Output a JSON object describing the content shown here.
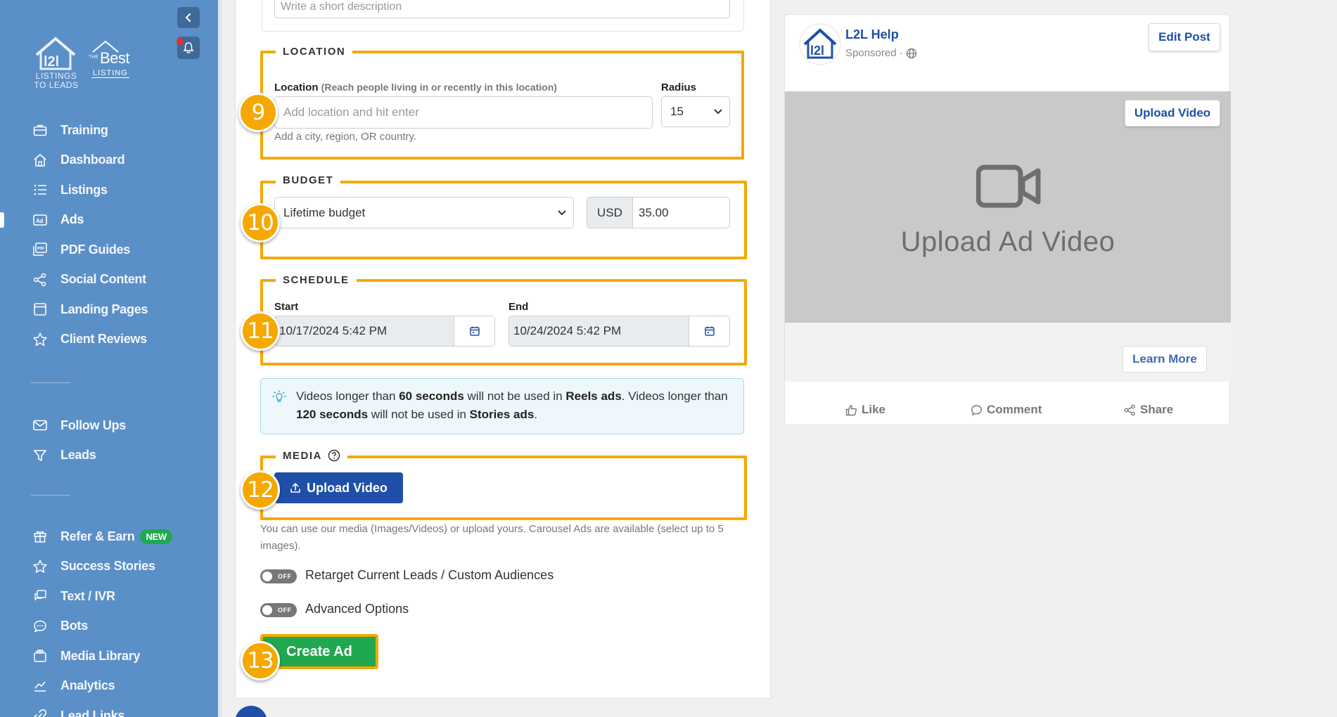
{
  "sidebar": {
    "logo_l2l_caption_1": "LISTINGS",
    "logo_l2l_caption_2": "TO LEADS",
    "logo_best_prefix": "THE",
    "logo_best_main": "Best",
    "logo_best_sub": "LISTING",
    "items": [
      {
        "label": "Training",
        "icon": "briefcase-icon"
      },
      {
        "label": "Dashboard",
        "icon": "home-icon"
      },
      {
        "label": "Listings",
        "icon": "list-icon"
      },
      {
        "label": "Ads",
        "icon": "ad-icon",
        "active": true
      },
      {
        "label": "PDF Guides",
        "icon": "pdf-icon"
      },
      {
        "label": "Social Content",
        "icon": "share-icon"
      },
      {
        "label": "Landing Pages",
        "icon": "window-icon"
      },
      {
        "label": "Client Reviews",
        "icon": "star-icon"
      },
      {
        "label": "Follow Ups",
        "icon": "envelope-icon"
      },
      {
        "label": "Leads",
        "icon": "filter-icon"
      },
      {
        "label": "Refer & Earn",
        "icon": "gift-icon",
        "badge": "NEW"
      },
      {
        "label": "Success Stories",
        "icon": "star-icon"
      },
      {
        "label": "Text / IVR",
        "icon": "chat-icon"
      },
      {
        "label": "Bots",
        "icon": "comment-icon"
      },
      {
        "label": "Media Library",
        "icon": "folder-icon"
      },
      {
        "label": "Analytics",
        "icon": "chart-icon"
      },
      {
        "label": "Lead Links",
        "icon": "link-icon"
      }
    ]
  },
  "form": {
    "description_placeholder": "Write a short description",
    "location": {
      "legend": "LOCATION",
      "label": "Location",
      "label_sub": "(Reach people living in or recently in this location)",
      "placeholder": "Add location and hit enter",
      "help": "Add a city, region, OR country.",
      "radius_label": "Radius",
      "radius_value": "15"
    },
    "budget": {
      "legend": "BUDGET",
      "type": "Lifetime budget",
      "currency": "USD",
      "amount": "35.00"
    },
    "schedule": {
      "legend": "SCHEDULE",
      "start_label": "Start",
      "start_value": "10/17/2024 5:42 PM",
      "end_label": "End",
      "end_value": "10/24/2024 5:42 PM"
    },
    "info": {
      "t1": "Videos longer than ",
      "b1": "60 seconds",
      "t2": " will not be used in ",
      "b2": "Reels ads",
      "t3": ". Videos longer than ",
      "b3": "120 seconds",
      "t4": " will not be used in ",
      "b4": "Stories ads",
      "t5": "."
    },
    "media": {
      "legend": "MEDIA",
      "upload_label": "Upload Video",
      "help": "You can use our media (Images/Videos) or upload yours. Carousel Ads are available (select up to 5 images)."
    },
    "toggles": [
      {
        "label": "Retarget Current Leads / Custom Audiences",
        "state": "OFF"
      },
      {
        "label": "Advanced Options",
        "state": "OFF"
      }
    ],
    "create_label": "Create Ad",
    "step_badges": [
      "9",
      "10",
      "11",
      "12",
      "13"
    ]
  },
  "preview": {
    "page_name": "L2L Help",
    "sponsored": "Sponsored ·",
    "edit_post": "Edit Post",
    "upload_video": "Upload Video",
    "media_title": "Upload Ad Video",
    "learn_more": "Learn More",
    "actions": [
      "Like",
      "Comment",
      "Share"
    ]
  },
  "colors": {
    "sidebar_bg": "#5b8fc7",
    "highlight": "#f5a800",
    "primary": "#1f4fa8",
    "success": "#1fa84f"
  }
}
